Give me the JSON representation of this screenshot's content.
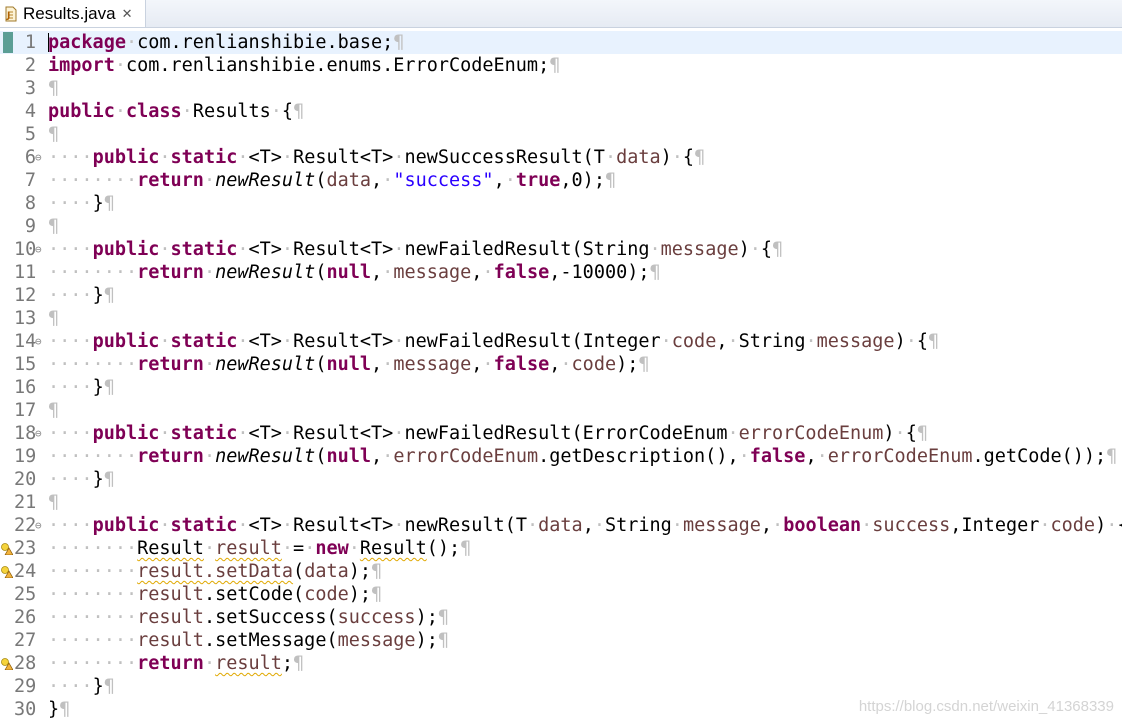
{
  "tab": {
    "title": "Results.java",
    "close": "✕"
  },
  "editor": {
    "lines": [
      {
        "n": "1",
        "fold": "",
        "warn": false,
        "current": true,
        "tokens": [
          [
            "kw",
            "package"
          ],
          [
            "ws",
            "·"
          ],
          [
            "n",
            "com.renlianshibie.base;"
          ],
          [
            "ws",
            "¶"
          ]
        ]
      },
      {
        "n": "2",
        "fold": "",
        "warn": false,
        "tokens": [
          [
            "kw",
            "import"
          ],
          [
            "ws",
            "·"
          ],
          [
            "n",
            "com.renlianshibie.enums.ErrorCodeEnum;"
          ],
          [
            "ws",
            "¶"
          ]
        ]
      },
      {
        "n": "3",
        "fold": "",
        "warn": false,
        "tokens": [
          [
            "ws",
            "¶"
          ]
        ]
      },
      {
        "n": "4",
        "fold": "",
        "warn": false,
        "tokens": [
          [
            "kw",
            "public"
          ],
          [
            "ws",
            "·"
          ],
          [
            "kw",
            "class"
          ],
          [
            "ws",
            "·"
          ],
          [
            "n",
            "Results"
          ],
          [
            "ws",
            "·"
          ],
          [
            "n",
            "{"
          ],
          [
            "ws",
            "¶"
          ]
        ]
      },
      {
        "n": "5",
        "fold": "",
        "warn": false,
        "tokens": [
          [
            "ws",
            "¶"
          ]
        ]
      },
      {
        "n": "6",
        "fold": "⊖",
        "warn": false,
        "tokens": [
          [
            "ws",
            "····"
          ],
          [
            "kw",
            "public"
          ],
          [
            "ws",
            "·"
          ],
          [
            "kw",
            "static"
          ],
          [
            "ws",
            "·"
          ],
          [
            "n",
            "<T>"
          ],
          [
            "ws",
            "·"
          ],
          [
            "n",
            "Result<T>"
          ],
          [
            "ws",
            "·"
          ],
          [
            "n",
            "newSuccessResult(T"
          ],
          [
            "ws",
            "·"
          ],
          [
            "var",
            "data"
          ],
          [
            "n",
            ")"
          ],
          [
            "ws",
            "·"
          ],
          [
            "n",
            "{"
          ],
          [
            "ws",
            "¶"
          ]
        ]
      },
      {
        "n": "7",
        "fold": "",
        "warn": false,
        "tokens": [
          [
            "ws",
            "········"
          ],
          [
            "kw",
            "return"
          ],
          [
            "ws",
            "·"
          ],
          [
            "it",
            "newResult"
          ],
          [
            "n",
            "("
          ],
          [
            "var",
            "data"
          ],
          [
            "n",
            ","
          ],
          [
            "ws",
            "·"
          ],
          [
            "str",
            "\"success\""
          ],
          [
            "n",
            ","
          ],
          [
            "ws",
            "·"
          ],
          [
            "kw",
            "true"
          ],
          [
            "n",
            ",0);"
          ],
          [
            "ws",
            "¶"
          ]
        ]
      },
      {
        "n": "8",
        "fold": "",
        "warn": false,
        "tokens": [
          [
            "ws",
            "····"
          ],
          [
            "n",
            "}"
          ],
          [
            "ws",
            "¶"
          ]
        ]
      },
      {
        "n": "9",
        "fold": "",
        "warn": false,
        "tokens": [
          [
            "ws",
            "¶"
          ]
        ]
      },
      {
        "n": "10",
        "fold": "⊖",
        "warn": false,
        "tokens": [
          [
            "ws",
            "····"
          ],
          [
            "kw",
            "public"
          ],
          [
            "ws",
            "·"
          ],
          [
            "kw",
            "static"
          ],
          [
            "ws",
            "·"
          ],
          [
            "n",
            "<T>"
          ],
          [
            "ws",
            "·"
          ],
          [
            "n",
            "Result<T>"
          ],
          [
            "ws",
            "·"
          ],
          [
            "n",
            "newFailedResult(String"
          ],
          [
            "ws",
            "·"
          ],
          [
            "var",
            "message"
          ],
          [
            "n",
            ")"
          ],
          [
            "ws",
            "·"
          ],
          [
            "n",
            "{"
          ],
          [
            "ws",
            "¶"
          ]
        ]
      },
      {
        "n": "11",
        "fold": "",
        "warn": false,
        "tokens": [
          [
            "ws",
            "········"
          ],
          [
            "kw",
            "return"
          ],
          [
            "ws",
            "·"
          ],
          [
            "it",
            "newResult"
          ],
          [
            "n",
            "("
          ],
          [
            "kw",
            "null"
          ],
          [
            "n",
            ","
          ],
          [
            "ws",
            "·"
          ],
          [
            "var",
            "message"
          ],
          [
            "n",
            ","
          ],
          [
            "ws",
            "·"
          ],
          [
            "kw",
            "false"
          ],
          [
            "n",
            ",-10000);"
          ],
          [
            "ws",
            "¶"
          ]
        ]
      },
      {
        "n": "12",
        "fold": "",
        "warn": false,
        "tokens": [
          [
            "ws",
            "····"
          ],
          [
            "n",
            "}"
          ],
          [
            "ws",
            "¶"
          ]
        ]
      },
      {
        "n": "13",
        "fold": "",
        "warn": false,
        "tokens": [
          [
            "ws",
            "¶"
          ]
        ]
      },
      {
        "n": "14",
        "fold": "⊖",
        "warn": false,
        "tokens": [
          [
            "ws",
            "····"
          ],
          [
            "kw",
            "public"
          ],
          [
            "ws",
            "·"
          ],
          [
            "kw",
            "static"
          ],
          [
            "ws",
            "·"
          ],
          [
            "n",
            "<T>"
          ],
          [
            "ws",
            "·"
          ],
          [
            "n",
            "Result<T>"
          ],
          [
            "ws",
            "·"
          ],
          [
            "n",
            "newFailedResult(Integer"
          ],
          [
            "ws",
            "·"
          ],
          [
            "var",
            "code"
          ],
          [
            "n",
            ","
          ],
          [
            "ws",
            "·"
          ],
          [
            "n",
            "String"
          ],
          [
            "ws",
            "·"
          ],
          [
            "var",
            "message"
          ],
          [
            "n",
            ")"
          ],
          [
            "ws",
            "·"
          ],
          [
            "n",
            "{"
          ],
          [
            "ws",
            "¶"
          ]
        ]
      },
      {
        "n": "15",
        "fold": "",
        "warn": false,
        "tokens": [
          [
            "ws",
            "········"
          ],
          [
            "kw",
            "return"
          ],
          [
            "ws",
            "·"
          ],
          [
            "it",
            "newResult"
          ],
          [
            "n",
            "("
          ],
          [
            "kw",
            "null"
          ],
          [
            "n",
            ","
          ],
          [
            "ws",
            "·"
          ],
          [
            "var",
            "message"
          ],
          [
            "n",
            ","
          ],
          [
            "ws",
            "·"
          ],
          [
            "kw",
            "false"
          ],
          [
            "n",
            ","
          ],
          [
            "ws",
            "·"
          ],
          [
            "var",
            "code"
          ],
          [
            "n",
            ");"
          ],
          [
            "ws",
            "¶"
          ]
        ]
      },
      {
        "n": "16",
        "fold": "",
        "warn": false,
        "tokens": [
          [
            "ws",
            "····"
          ],
          [
            "n",
            "}"
          ],
          [
            "ws",
            "¶"
          ]
        ]
      },
      {
        "n": "17",
        "fold": "",
        "warn": false,
        "tokens": [
          [
            "ws",
            "¶"
          ]
        ]
      },
      {
        "n": "18",
        "fold": "⊖",
        "warn": false,
        "tokens": [
          [
            "ws",
            "····"
          ],
          [
            "kw",
            "public"
          ],
          [
            "ws",
            "·"
          ],
          [
            "kw",
            "static"
          ],
          [
            "ws",
            "·"
          ],
          [
            "n",
            "<T>"
          ],
          [
            "ws",
            "·"
          ],
          [
            "n",
            "Result<T>"
          ],
          [
            "ws",
            "·"
          ],
          [
            "n",
            "newFailedResult(ErrorCodeEnum"
          ],
          [
            "ws",
            "·"
          ],
          [
            "var",
            "errorCodeEnum"
          ],
          [
            "n",
            ")"
          ],
          [
            "ws",
            "·"
          ],
          [
            "n",
            "{"
          ],
          [
            "ws",
            "¶"
          ]
        ]
      },
      {
        "n": "19",
        "fold": "",
        "warn": false,
        "tokens": [
          [
            "ws",
            "········"
          ],
          [
            "kw",
            "return"
          ],
          [
            "ws",
            "·"
          ],
          [
            "it",
            "newResult"
          ],
          [
            "n",
            "("
          ],
          [
            "kw",
            "null"
          ],
          [
            "n",
            ","
          ],
          [
            "ws",
            "·"
          ],
          [
            "var",
            "errorCodeEnum"
          ],
          [
            "n",
            ".getDescription(),"
          ],
          [
            "ws",
            "·"
          ],
          [
            "kw",
            "false"
          ],
          [
            "n",
            ","
          ],
          [
            "ws",
            "·"
          ],
          [
            "var",
            "errorCodeEnum"
          ],
          [
            "n",
            ".getCode());"
          ],
          [
            "ws",
            "¶"
          ]
        ]
      },
      {
        "n": "20",
        "fold": "",
        "warn": false,
        "tokens": [
          [
            "ws",
            "····"
          ],
          [
            "n",
            "}"
          ],
          [
            "ws",
            "¶"
          ]
        ]
      },
      {
        "n": "21",
        "fold": "",
        "warn": false,
        "tokens": [
          [
            "ws",
            "¶"
          ]
        ]
      },
      {
        "n": "22",
        "fold": "⊖",
        "warn": false,
        "tokens": [
          [
            "ws",
            "····"
          ],
          [
            "kw",
            "public"
          ],
          [
            "ws",
            "·"
          ],
          [
            "kw",
            "static"
          ],
          [
            "ws",
            "·"
          ],
          [
            "n",
            "<T>"
          ],
          [
            "ws",
            "·"
          ],
          [
            "n",
            "Result<T>"
          ],
          [
            "ws",
            "·"
          ],
          [
            "n",
            "newResult(T"
          ],
          [
            "ws",
            "·"
          ],
          [
            "var",
            "data"
          ],
          [
            "n",
            ","
          ],
          [
            "ws",
            "·"
          ],
          [
            "n",
            "String"
          ],
          [
            "ws",
            "·"
          ],
          [
            "var",
            "message"
          ],
          [
            "n",
            ","
          ],
          [
            "ws",
            "·"
          ],
          [
            "kw",
            "boolean"
          ],
          [
            "ws",
            "·"
          ],
          [
            "var",
            "success"
          ],
          [
            "n",
            ",Integer"
          ],
          [
            "ws",
            "·"
          ],
          [
            "var",
            "code"
          ],
          [
            "n",
            ")"
          ],
          [
            "ws",
            "·"
          ],
          [
            "n",
            "{"
          ],
          [
            "ws",
            "¶"
          ]
        ]
      },
      {
        "n": "23",
        "fold": "",
        "warn": true,
        "tokens": [
          [
            "ws",
            "········"
          ],
          [
            "squig",
            "Result"
          ],
          [
            "ws",
            "·"
          ],
          [
            "var squig",
            "result"
          ],
          [
            "ws",
            "·"
          ],
          [
            "n",
            "="
          ],
          [
            "ws",
            "·"
          ],
          [
            "kw",
            "new"
          ],
          [
            "ws",
            "·"
          ],
          [
            "squig",
            "Result"
          ],
          [
            "n",
            "();"
          ],
          [
            "ws",
            "¶"
          ]
        ]
      },
      {
        "n": "24",
        "fold": "",
        "warn": true,
        "tokens": [
          [
            "ws",
            "········"
          ],
          [
            "var squig",
            "result.setData"
          ],
          [
            "n",
            "("
          ],
          [
            "var",
            "data"
          ],
          [
            "n",
            ");"
          ],
          [
            "ws",
            "¶"
          ]
        ]
      },
      {
        "n": "25",
        "fold": "",
        "warn": false,
        "tokens": [
          [
            "ws",
            "········"
          ],
          [
            "var",
            "result"
          ],
          [
            "n",
            ".setCode("
          ],
          [
            "var",
            "code"
          ],
          [
            "n",
            ");"
          ],
          [
            "ws",
            "¶"
          ]
        ]
      },
      {
        "n": "26",
        "fold": "",
        "warn": false,
        "tokens": [
          [
            "ws",
            "········"
          ],
          [
            "var",
            "result"
          ],
          [
            "n",
            ".setSuccess("
          ],
          [
            "var",
            "success"
          ],
          [
            "n",
            ");"
          ],
          [
            "ws",
            "¶"
          ]
        ]
      },
      {
        "n": "27",
        "fold": "",
        "warn": false,
        "tokens": [
          [
            "ws",
            "········"
          ],
          [
            "var",
            "result"
          ],
          [
            "n",
            ".setMessage("
          ],
          [
            "var",
            "message"
          ],
          [
            "n",
            ");"
          ],
          [
            "ws",
            "¶"
          ]
        ]
      },
      {
        "n": "28",
        "fold": "",
        "warn": true,
        "tokens": [
          [
            "ws",
            "········"
          ],
          [
            "kw",
            "return"
          ],
          [
            "ws",
            "·"
          ],
          [
            "var squig",
            "result"
          ],
          [
            "n",
            ";"
          ],
          [
            "ws",
            "¶"
          ]
        ]
      },
      {
        "n": "29",
        "fold": "",
        "warn": false,
        "tokens": [
          [
            "ws",
            "····"
          ],
          [
            "n",
            "}"
          ],
          [
            "ws",
            "¶"
          ]
        ]
      },
      {
        "n": "30",
        "fold": "",
        "warn": false,
        "tokens": [
          [
            "n",
            "}"
          ],
          [
            "ws",
            "¶"
          ]
        ]
      }
    ]
  },
  "watermark": "https://blog.csdn.net/weixin_41368339"
}
